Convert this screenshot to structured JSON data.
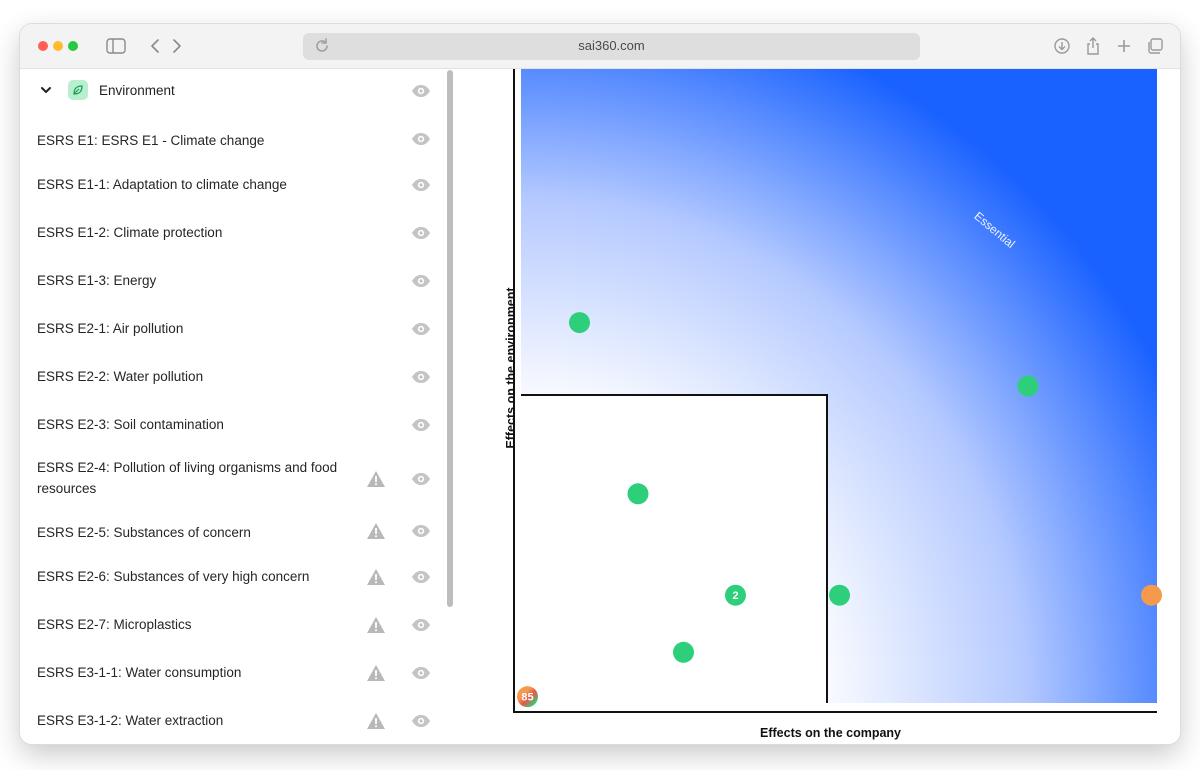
{
  "browser": {
    "url": "sai360.com"
  },
  "sidebar": {
    "section_title": "Environment",
    "section_icon": "leaf-icon",
    "items": [
      {
        "label": "ESRS E1: ESRS E1 - Climate change",
        "warning": false
      },
      {
        "label": "ESRS E1-1: Adaptation to climate change",
        "warning": false
      },
      {
        "label": "ESRS E1-2: Climate protection",
        "warning": false
      },
      {
        "label": "ESRS E1-3: Energy",
        "warning": false
      },
      {
        "label": "ESRS E2-1: Air pollution",
        "warning": false
      },
      {
        "label": "ESRS E2-2: Water pollution",
        "warning": false
      },
      {
        "label": "ESRS E2-3: Soil contamination",
        "warning": false
      },
      {
        "label": "ESRS E2-4: Pollution of living organisms and food resources",
        "warning": true
      },
      {
        "label": "ESRS E2-5: Substances of concern",
        "warning": true
      },
      {
        "label": "ESRS E2-6: Substances of very high concern",
        "warning": true
      },
      {
        "label": "ESRS E2-7: Microplastics",
        "warning": true
      },
      {
        "label": "ESRS E3-1-1: Water consumption",
        "warning": true
      },
      {
        "label": "ESRS E3-1-2: Water extraction",
        "warning": true
      }
    ]
  },
  "chart_data": {
    "type": "scatter",
    "xlabel": "Effects on the company",
    "ylabel": "Effects on the environment",
    "region_label": "Essential",
    "colors": {
      "green": "#2ecf7a",
      "orange": "#f59a4d",
      "gradient_start": "#ffffff",
      "gradient_end": "#1a62ff"
    },
    "points": [
      {
        "x": 0.09,
        "y": 0.6,
        "label": "",
        "color": "green"
      },
      {
        "x": 0.78,
        "y": 0.5,
        "label": "",
        "color": "green"
      },
      {
        "x": 0.18,
        "y": 0.33,
        "label": "",
        "color": "green"
      },
      {
        "x": 0.33,
        "y": 0.17,
        "label": "2",
        "color": "green"
      },
      {
        "x": 0.49,
        "y": 0.17,
        "label": "",
        "color": "green"
      },
      {
        "x": 0.25,
        "y": 0.08,
        "label": "",
        "color": "green"
      },
      {
        "x": 0.97,
        "y": 0.17,
        "label": "",
        "color": "orange"
      },
      {
        "x": 0.01,
        "y": 0.01,
        "label": "85",
        "color": "mixed"
      }
    ]
  }
}
